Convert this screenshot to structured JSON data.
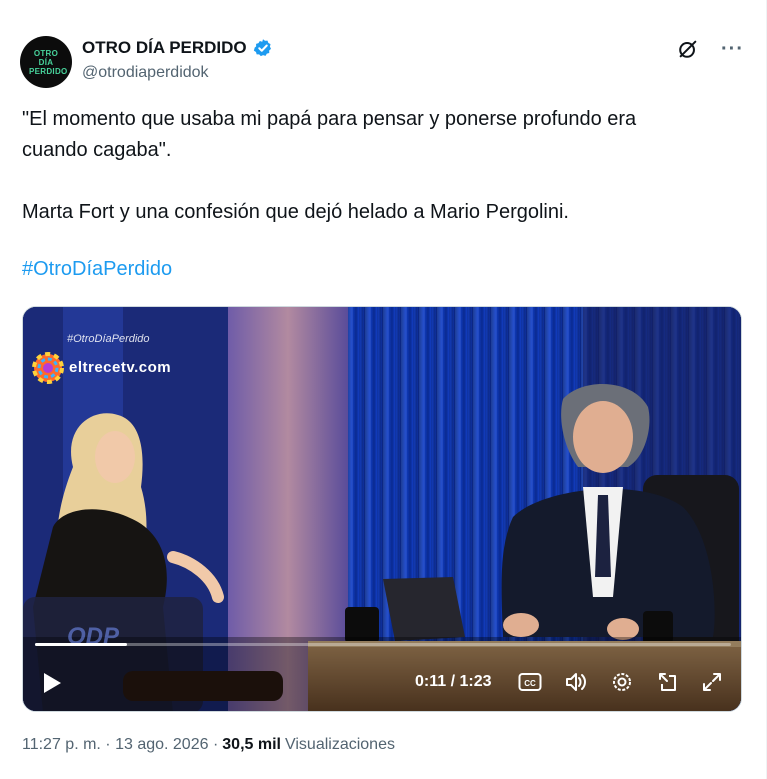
{
  "author": {
    "display_name": "OTRO DÍA PERDIDO",
    "handle": "@otrodiaperdidok",
    "avatar_text": "OTRO DÍA PERDIDO",
    "verified": true
  },
  "actions": {
    "grok_icon": "grok-icon",
    "more_label": "···"
  },
  "tweet": {
    "text": "\"El momento que usaba mi papá para pensar y ponerse profundo era\ncuando cagaba\".\n\nMarta Fort y una confesión que dejó helado a Mario Pergolini.",
    "hashtag": "#OtroDíaPerdido"
  },
  "video": {
    "watermark_hashtag": "#OtroDíaPerdido",
    "watermark_site": "eltrecetv.com",
    "watermark_odp": "ODP",
    "time_display": "0:11 / 1:23",
    "progress": 0.1325,
    "controls": [
      "play-icon",
      "captions-icon",
      "volume-icon",
      "settings-icon",
      "popout-icon",
      "fullscreen-icon"
    ]
  },
  "meta": {
    "timestamp": "11:27 p. m. · 13 ago. 2026 · ",
    "views_count": "30,5 mil",
    "views_label": "Visualizaciones"
  },
  "colors": {
    "link": "#1d9bf0",
    "secondary_text": "#536471",
    "verified": "#1d9bf0",
    "avatar_accent": "#47d39b"
  }
}
